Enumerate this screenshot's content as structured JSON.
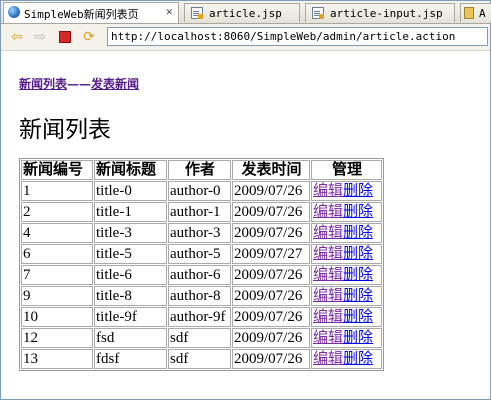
{
  "tabs": [
    {
      "label": "SimpleWeb新闻列表页",
      "icon": "globe-icon",
      "active": true,
      "closable": true
    },
    {
      "label": "article.jsp",
      "icon": "jsp-file-icon",
      "active": false
    },
    {
      "label": "article-input.jsp",
      "icon": "jsp-file-icon",
      "active": false
    },
    {
      "label": "A",
      "icon": "java-file-icon",
      "active": false
    }
  ],
  "toolbar": {
    "url": "http://localhost:8060/SimpleWeb/admin/article.action"
  },
  "breadcrumb": {
    "list_link": "新闻列表",
    "separator": "——",
    "publish_link": "发表新闻"
  },
  "page_title": "新闻列表",
  "table": {
    "headers": [
      "新闻编号",
      "新闻标题",
      "作者",
      "发表时间",
      "管理"
    ],
    "edit_label": "编辑",
    "delete_label": "删除",
    "rows": [
      {
        "id": "1",
        "title": "title-0",
        "author": "author-0",
        "date": "2009/07/26"
      },
      {
        "id": "2",
        "title": "title-1",
        "author": "author-1",
        "date": "2009/07/26"
      },
      {
        "id": "4",
        "title": "title-3",
        "author": "author-3",
        "date": "2009/07/26"
      },
      {
        "id": "6",
        "title": "title-5",
        "author": "author-5",
        "date": "2009/07/27"
      },
      {
        "id": "7",
        "title": "title-6",
        "author": "author-6",
        "date": "2009/07/26"
      },
      {
        "id": "9",
        "title": "title-8",
        "author": "author-8",
        "date": "2009/07/26"
      },
      {
        "id": "10",
        "title": "title-9f",
        "author": "author-9f",
        "date": "2009/07/26"
      },
      {
        "id": "12",
        "title": "fsd",
        "author": "sdf",
        "date": "2009/07/26"
      },
      {
        "id": "13",
        "title": "fdsf",
        "author": "sdf",
        "date": "2009/07/26"
      }
    ]
  },
  "colors": {
    "visited_link": "#551a8b",
    "link": "#0000ee",
    "border": "#7f9db9"
  }
}
